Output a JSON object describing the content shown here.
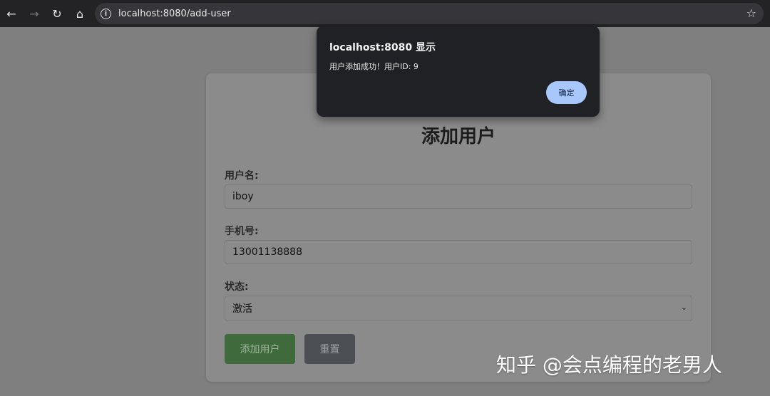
{
  "browser": {
    "url": "localhost:8080/add-user",
    "back_icon": "←",
    "forward_icon": "→",
    "reload_icon": "↻",
    "home_icon": "⌂",
    "info_icon": "i",
    "star_icon": "☆"
  },
  "form": {
    "title": "添加用户",
    "username_label": "用户名:",
    "username_value": "iboy",
    "phone_label": "手机号:",
    "phone_value": "13001138888",
    "status_label": "状态:",
    "status_value": "激活",
    "submit_label": "添加用户",
    "reset_label": "重置"
  },
  "dialog": {
    "title": "localhost:8080 显示",
    "message": "用户添加成功！用户ID: 9",
    "ok_label": "确定"
  },
  "watermark": {
    "text": "知乎 @会点编程的老男人"
  },
  "colors": {
    "submit_button": "#3e6a3c",
    "reset_button": "#4b4f54",
    "dialog_ok": "#a8c7fa",
    "dialog_bg": "#202124"
  }
}
